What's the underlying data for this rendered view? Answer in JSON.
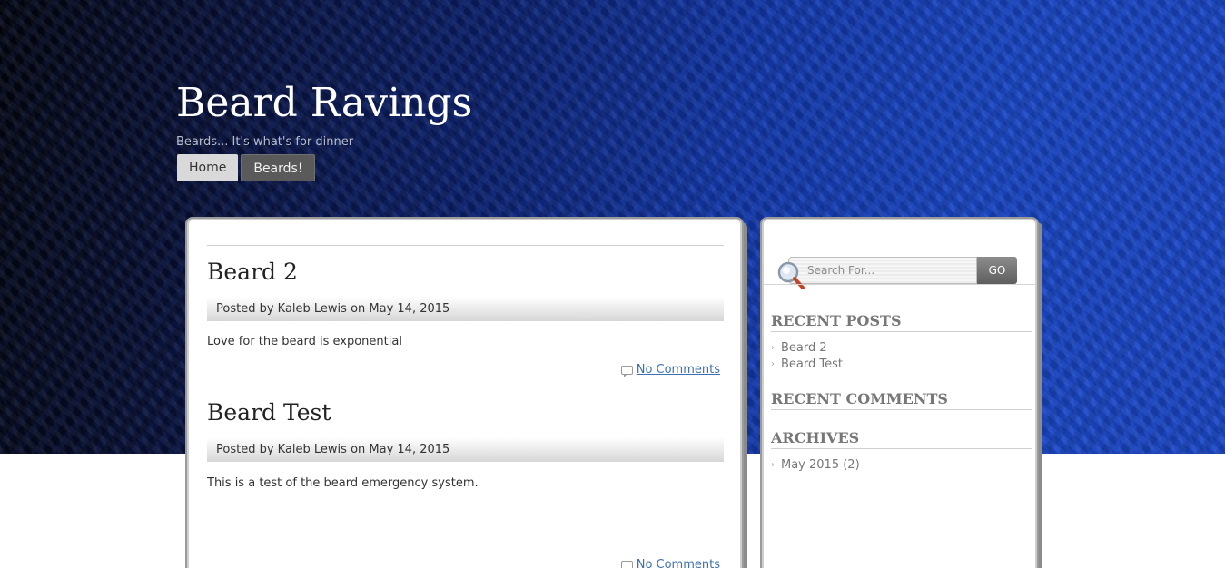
{
  "header": {
    "site_title": "Beard Ravings",
    "tagline": "Beards... It's what's for dinner"
  },
  "nav": {
    "home": "Home",
    "beards": "Beards!"
  },
  "posts": [
    {
      "title": "Beard 2",
      "meta": "Posted by Kaleb Lewis on May 14, 2015",
      "body": "Love for the beard is exponential",
      "comments": "No Comments"
    },
    {
      "title": "Beard Test",
      "meta": "Posted by Kaleb Lewis on May 14, 2015",
      "body": "This is a test of the beard emergency system.",
      "comments": "No Comments"
    }
  ],
  "sidebar": {
    "search": {
      "placeholder": "Search For...",
      "button": "GO"
    },
    "recent_posts": {
      "title": "RECENT POSTS",
      "items": [
        "Beard 2",
        "Beard Test"
      ]
    },
    "recent_comments": {
      "title": "RECENT COMMENTS"
    },
    "archives": {
      "title": "ARCHIVES",
      "items": [
        "May 2015 (2)"
      ]
    }
  },
  "colors": {
    "hero_blue": "#1a46c4",
    "link": "#3c6fb4",
    "button_dark": "#5a5a5a"
  }
}
